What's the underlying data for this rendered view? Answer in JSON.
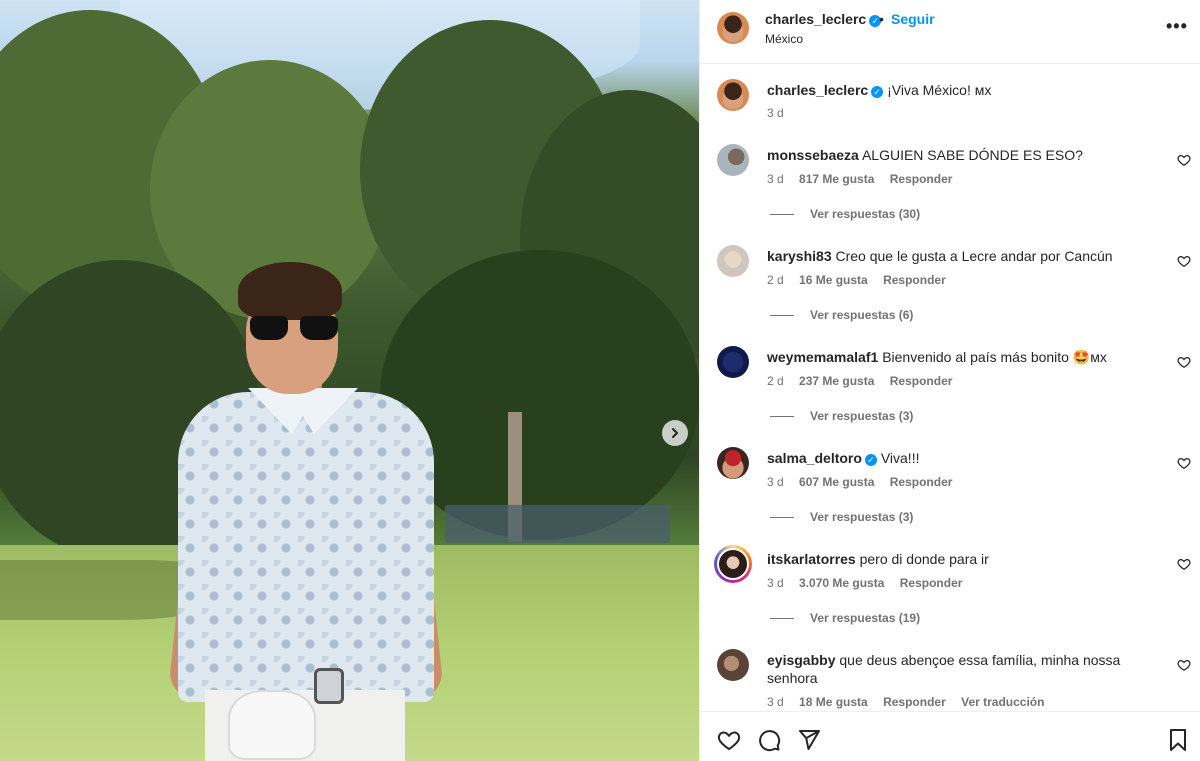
{
  "header": {
    "username": "charles_leclerc",
    "verified_mark": "✓",
    "separator": "•",
    "follow_label": "Seguir",
    "location": "México",
    "more_label": "•••"
  },
  "caption": {
    "username": "charles_leclerc",
    "verified_mark": "✓",
    "text": "¡Viva México! ᴍx",
    "time": "3 d"
  },
  "comments": [
    {
      "username": "monssebaeza",
      "text": "ALGUIEN SABE DÓNDE ES ESO?",
      "time": "3 d",
      "likes": "817 Me gusta",
      "reply": "Responder",
      "replies": "Ver respuestas (30)"
    },
    {
      "username": "karyshi83",
      "text": "Creo que le gusta a Lecre andar por Cancún",
      "time": "2 d",
      "likes": "16 Me gusta",
      "reply": "Responder",
      "replies": "Ver respuestas (6)"
    },
    {
      "username": "weymemamalaf1",
      "text": "Bienvenido al país más bonito 🤩ᴍx",
      "time": "2 d",
      "likes": "237 Me gusta",
      "reply": "Responder",
      "replies": "Ver respuestas (3)"
    },
    {
      "username": "salma_deltoro",
      "verified_mark": "✓",
      "text": "Viva!!!",
      "time": "3 d",
      "likes": "607 Me gusta",
      "reply": "Responder",
      "replies": "Ver respuestas (3)"
    },
    {
      "username": "itskarlatorres",
      "text": "pero di donde para ir",
      "time": "3 d",
      "likes": "3.070 Me gusta",
      "reply": "Responder",
      "replies": "Ver respuestas (19)"
    },
    {
      "username": "eyisgabby",
      "text": "que deus abençoe essa família, minha nossa senhora",
      "time": "3 d",
      "likes": "18 Me gusta",
      "reply": "Responder",
      "translate": "Ver traducción"
    }
  ],
  "icons": {
    "like": "heart-icon",
    "comment": "comment-icon",
    "share": "send-icon",
    "save": "bookmark-icon",
    "next": "chevron-right-icon",
    "more": "more-icon"
  },
  "colors": {
    "accent": "#0095f6",
    "text": "#262626",
    "muted": "#737373",
    "border": "#efefef"
  }
}
